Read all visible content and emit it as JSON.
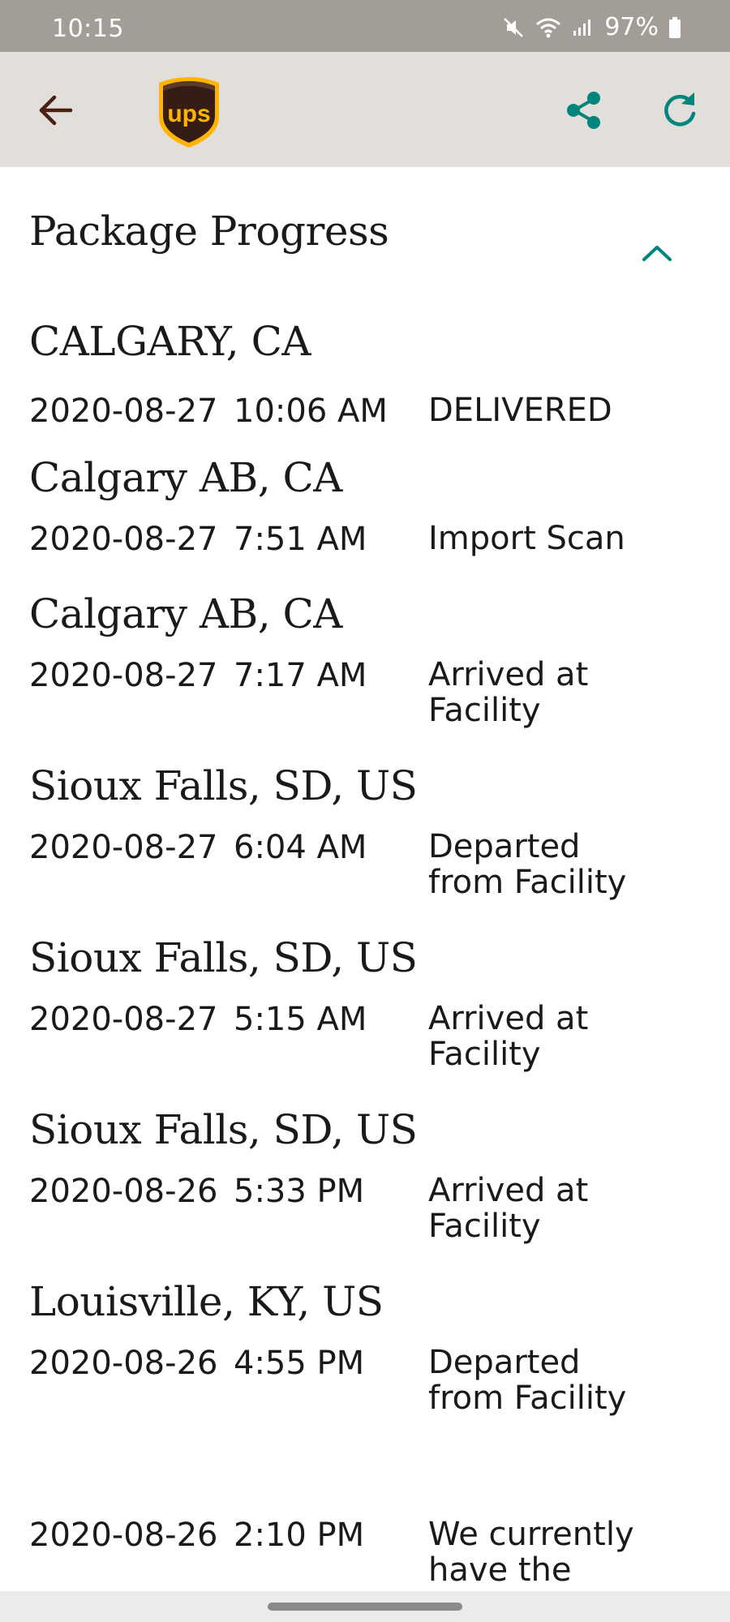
{
  "status_bar": {
    "time": "10:15",
    "battery": "97%",
    "icons": [
      "mute-icon",
      "wifi-icon",
      "signal-icon",
      "battery-icon"
    ]
  },
  "app_bar": {
    "back_icon": "arrow-left-icon",
    "logo": "ups-logo",
    "logo_text": "ups",
    "share_icon": "share-icon",
    "refresh_icon": "refresh-icon"
  },
  "colors": {
    "status_bar_bg": "#a39d97",
    "app_bar_bg": "#e2dfdb",
    "back_arrow": "#4a1f14",
    "accent_teal": "#00857d",
    "ups_brown": "#351c15",
    "ups_gold": "#ffb500"
  },
  "section": {
    "title": "Package Progress",
    "collapse_icon": "chevron-up-icon"
  },
  "events": [
    {
      "location": "CALGARY, CA",
      "date": "2020-08-27",
      "time": "10:06 AM",
      "status_lines": [
        "DELIVERED"
      ]
    },
    {
      "location": "Calgary AB, CA",
      "date": "2020-08-27",
      "time": "7:51 AM",
      "status_lines": [
        "Import Scan"
      ]
    },
    {
      "location": "Calgary AB, CA",
      "date": "2020-08-27",
      "time": "7:17 AM",
      "status_lines": [
        "Arrived at",
        "Facility"
      ]
    },
    {
      "location": "Sioux Falls, SD, US",
      "date": "2020-08-27",
      "time": "6:04 AM",
      "status_lines": [
        "Departed",
        "from Facility"
      ]
    },
    {
      "location": "Sioux Falls, SD, US",
      "date": "2020-08-27",
      "time": "5:15 AM",
      "status_lines": [
        "Arrived at",
        "Facility"
      ]
    },
    {
      "location": "Sioux Falls, SD, US",
      "date": "2020-08-26",
      "time": "5:33 PM",
      "status_lines": [
        "Arrived at",
        "Facility"
      ]
    },
    {
      "location": "Louisville, KY, US",
      "date": "2020-08-26",
      "time": "4:55 PM",
      "status_lines": [
        "Departed",
        "from Facility"
      ]
    },
    {
      "location": "",
      "date": "2020-08-26",
      "time": "2:10 PM",
      "status_lines": [
        "We currently",
        "have the"
      ]
    }
  ]
}
